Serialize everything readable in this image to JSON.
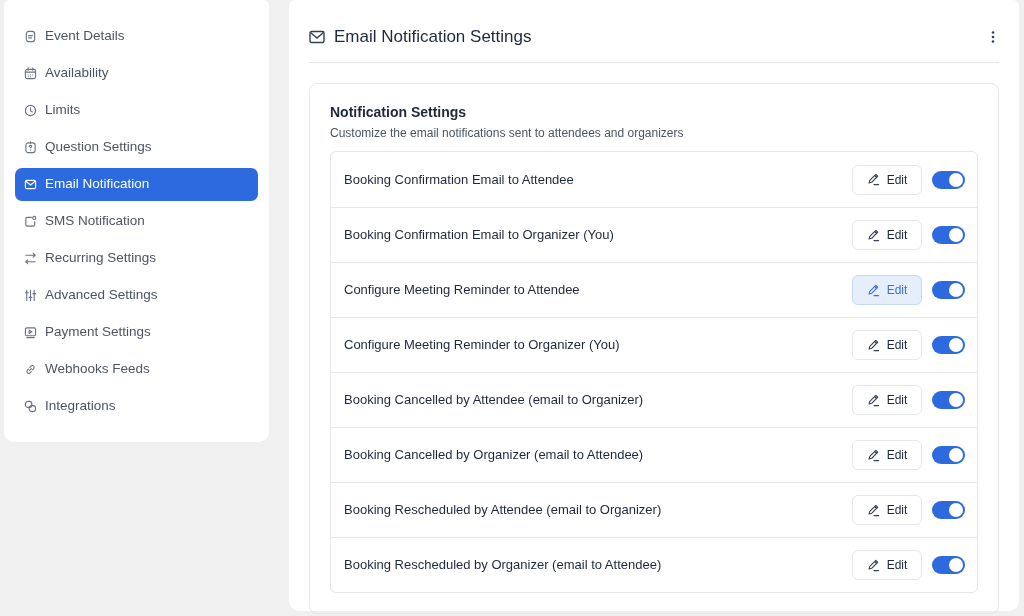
{
  "sidebar": {
    "items": [
      {
        "label": "Event Details",
        "selected": false
      },
      {
        "label": "Availability",
        "selected": false
      },
      {
        "label": "Limits",
        "selected": false
      },
      {
        "label": "Question Settings",
        "selected": false
      },
      {
        "label": "Email Notification",
        "selected": true
      },
      {
        "label": "SMS Notification",
        "selected": false
      },
      {
        "label": "Recurring Settings",
        "selected": false
      },
      {
        "label": "Advanced Settings",
        "selected": false
      },
      {
        "label": "Payment Settings",
        "selected": false
      },
      {
        "label": "Webhooks Feeds",
        "selected": false
      },
      {
        "label": "Integrations",
        "selected": false
      }
    ]
  },
  "panel": {
    "title": "Email Notification Settings"
  },
  "section": {
    "title": "Notification Settings",
    "subtitle": "Customize the email notifications sent to attendees and organizers"
  },
  "notifications": [
    {
      "label": "Booking Confirmation Email to Attendee",
      "edit_label": "Edit",
      "hovered": false,
      "on": true
    },
    {
      "label": "Booking Confirmation Email to Organizer (You)",
      "edit_label": "Edit",
      "hovered": false,
      "on": true
    },
    {
      "label": "Configure Meeting Reminder to Attendee",
      "edit_label": "Edit",
      "hovered": true,
      "on": true
    },
    {
      "label": "Configure Meeting Reminder to Organizer (You)",
      "edit_label": "Edit",
      "hovered": false,
      "on": true
    },
    {
      "label": "Booking Cancelled by Attendee (email to Organizer)",
      "edit_label": "Edit",
      "hovered": false,
      "on": true
    },
    {
      "label": "Booking Cancelled by Organizer (email to Attendee)",
      "edit_label": "Edit",
      "hovered": false,
      "on": true
    },
    {
      "label": "Booking Rescheduled by Attendee (email to Organizer)",
      "edit_label": "Edit",
      "hovered": false,
      "on": true
    },
    {
      "label": "Booking Rescheduled by Organizer (email to Attendee)",
      "edit_label": "Edit",
      "hovered": false,
      "on": true
    }
  ]
}
